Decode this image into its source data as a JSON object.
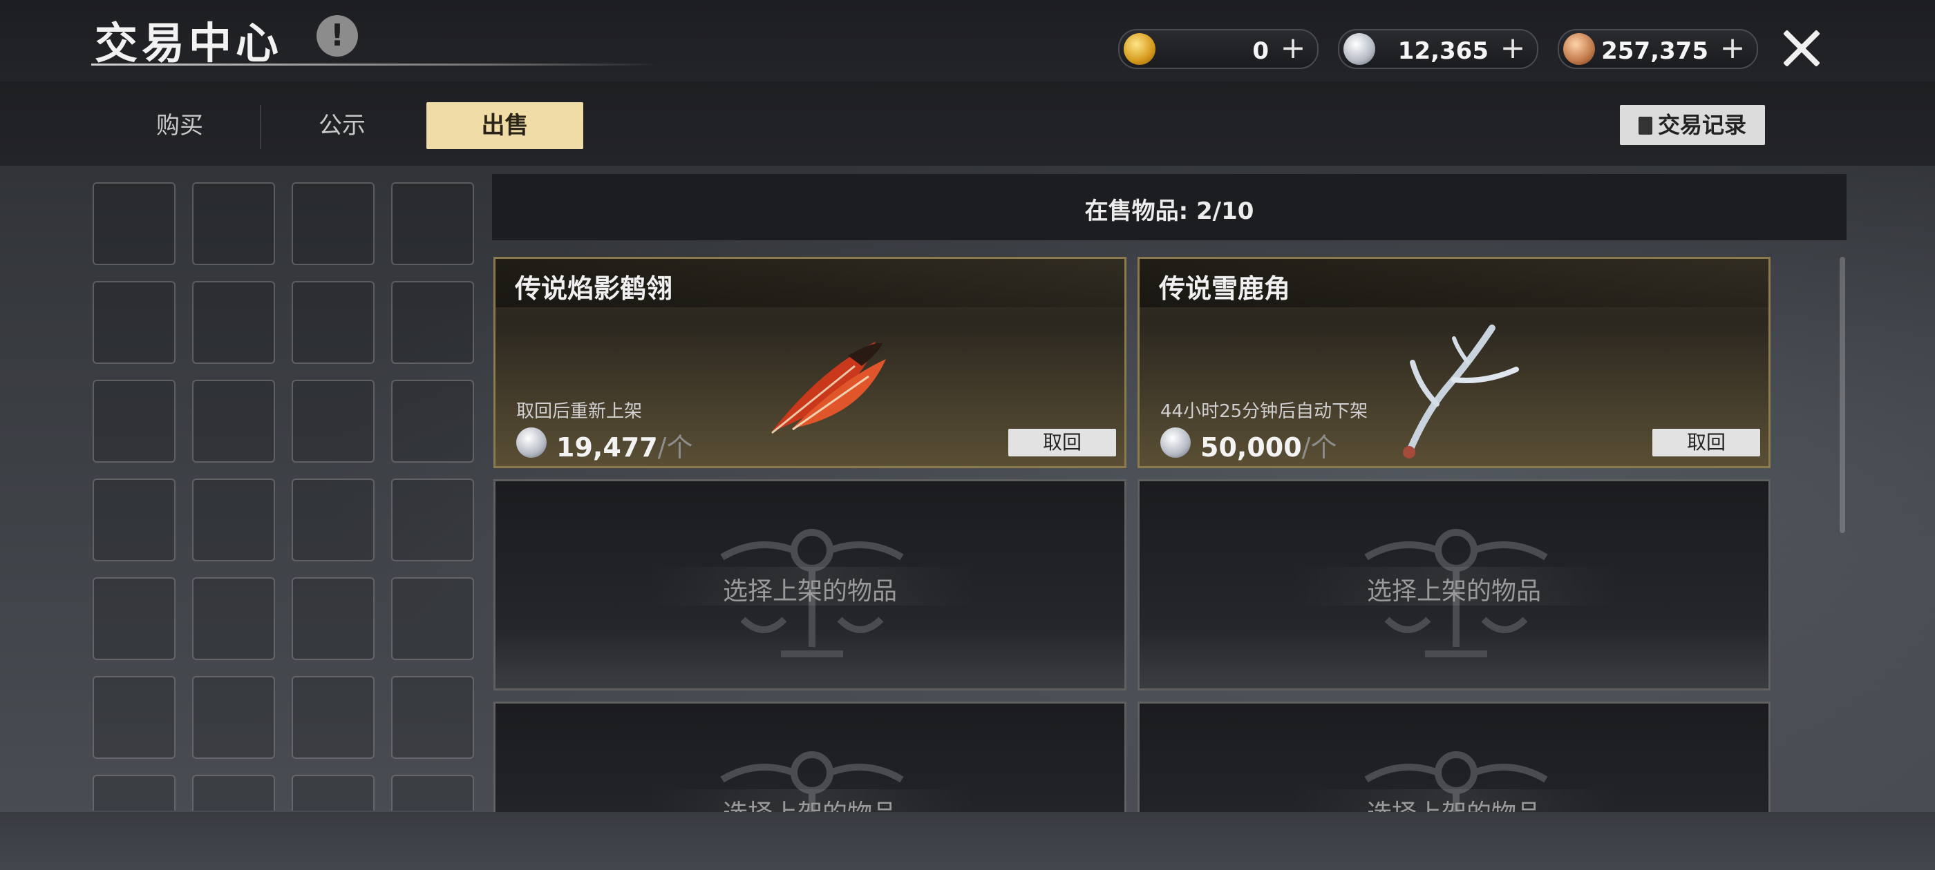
{
  "header": {
    "title": "交易中心",
    "info_icon": "!",
    "currencies": [
      {
        "type": "gold",
        "icon": "gold-coin-icon",
        "amount": "0",
        "add_symbol": "+"
      },
      {
        "type": "silver",
        "icon": "silver-coin-icon",
        "amount": "12,365",
        "add_symbol": "+"
      },
      {
        "type": "copper",
        "icon": "copper-coin-icon",
        "amount": "257,375",
        "add_symbol": "+"
      }
    ]
  },
  "tabs": [
    {
      "label": "购买",
      "active": false
    },
    {
      "label": "公示",
      "active": false
    },
    {
      "label": "出售",
      "active": true
    }
  ],
  "record_button": "交易记录",
  "sale": {
    "count_label": "在售物品: 2/10",
    "listed": [
      {
        "name": "传说焰影鹤翎",
        "status": "取回后重新上架",
        "price": "19,477",
        "unit": "/个",
        "action": "取回"
      },
      {
        "name": "传说雪鹿角",
        "status": "44小时25分钟后自动下架",
        "price": "50,000",
        "unit": "/个",
        "action": "取回"
      }
    ],
    "empty_slot_label": "选择上架的物品"
  }
}
